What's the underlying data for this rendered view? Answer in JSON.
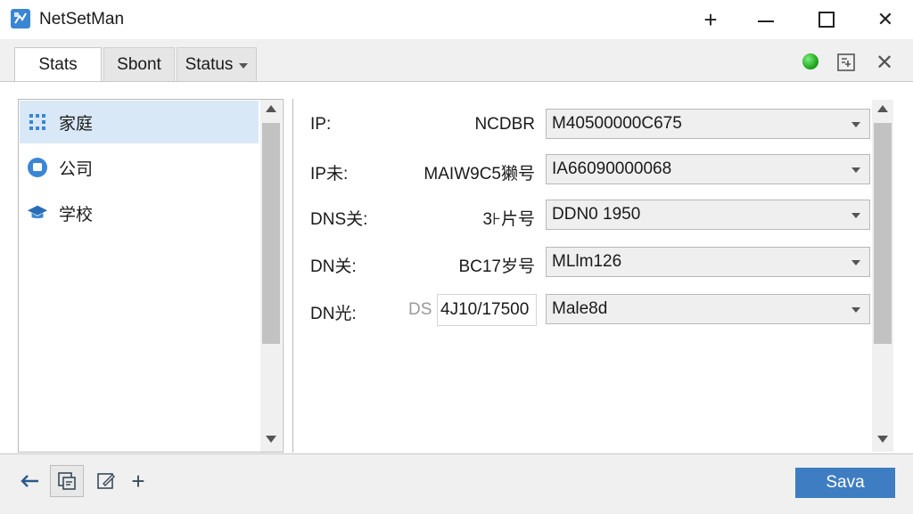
{
  "window": {
    "title": "NetSetMan",
    "controls": {
      "new": "+",
      "maximize": "☐",
      "close": "✕"
    }
  },
  "tabs": [
    {
      "label": "Stats",
      "active": true
    },
    {
      "label": "Sbont",
      "active": false
    },
    {
      "label": "Status",
      "active": false,
      "has_dropdown": true
    }
  ],
  "header_right": {
    "status_color": "#22a822",
    "icons": [
      "status-dot",
      "network-panel-icon",
      "close-icon"
    ],
    "close_glyph": "✕"
  },
  "profiles": [
    {
      "label": "家庭",
      "icon": "grid-icon",
      "selected": true
    },
    {
      "label": "公司",
      "icon": "company-icon",
      "selected": false
    },
    {
      "label": "学校",
      "icon": "graduation-cap-icon",
      "selected": false
    }
  ],
  "form_rows": [
    {
      "label": "IP:",
      "mid": "NCDBR",
      "value": "M40500000C675"
    },
    {
      "label": "IP未:",
      "mid": "MAIW9C5獭号",
      "value": "IA66090000068"
    },
    {
      "label": "DNS关:",
      "mid": "3⊦片号",
      "value": "DDN0 1950"
    },
    {
      "label": "DN关:",
      "mid": "BC17岁号",
      "value": "MLlm126"
    },
    {
      "label": "DN光:",
      "mid_prefix": "DS",
      "mid": "4J10/17500",
      "value": "Male8d"
    }
  ],
  "bottom": {
    "icons": [
      "back-arrow-icon",
      "copy-profile-icon",
      "edit-icon",
      "add-icon"
    ],
    "add_glyph": "+",
    "save_label": "Sava"
  },
  "colors": {
    "accent": "#3e7dc2",
    "selection": "#d9e8f7"
  }
}
